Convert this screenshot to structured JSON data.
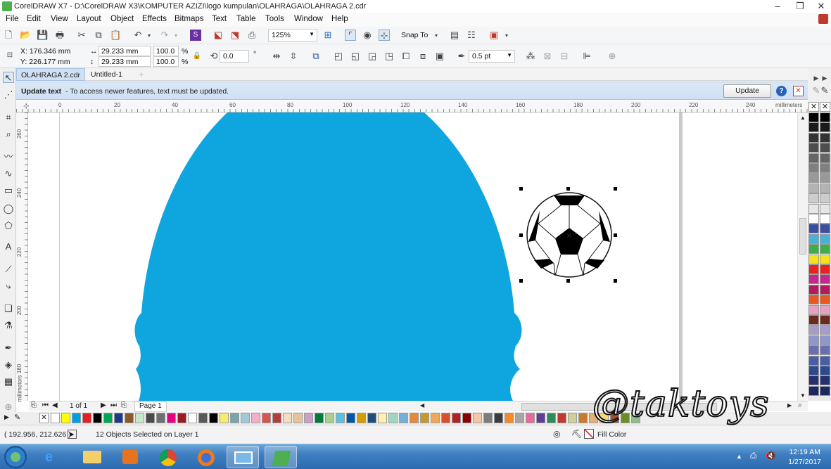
{
  "title": "CorelDRAW X7 - D:\\CorelDRAW X3\\KOMPUTER  AZIZI\\logo kumpulan\\OLAHRAGA\\OLAHRAGA 2.cdr",
  "menu": [
    "File",
    "Edit",
    "View",
    "Layout",
    "Object",
    "Effects",
    "Bitmaps",
    "Text",
    "Table",
    "Tools",
    "Window",
    "Help"
  ],
  "toolbar": {
    "zoom": "125%",
    "snap_to": "Snap To"
  },
  "properties": {
    "x": "X: 176.346 mm",
    "y": "Y: 226.177 mm",
    "width": "29.233 mm",
    "height": "29.233 mm",
    "scale_x": "100.0",
    "scale_y": "100.0",
    "percent": "%",
    "rotation": "0.0",
    "degree": "°",
    "outline": "0.5 pt"
  },
  "doc_tabs": [
    "OLAHRAGA 2.cdr",
    "Untitled-1"
  ],
  "notification": {
    "bold": "Update text",
    "message": "-  To access newer features, text must be updated.",
    "button": "Update"
  },
  "ruler": {
    "h_ticks": [
      "0",
      "20",
      "40",
      "60",
      "80",
      "100",
      "120",
      "140",
      "160",
      "180",
      "200",
      "220",
      "240"
    ],
    "unit": "millimeters",
    "v_ticks": [
      "260",
      "240",
      "220",
      "200",
      "180"
    ],
    "v_unit": "millimeters"
  },
  "page_nav": {
    "count": "1 of 1",
    "page": "Page 1"
  },
  "status": {
    "coords": "( 192.956, 212.626 )",
    "selection": "12 Objects Selected on Layer 1",
    "fill": "Fill Color"
  },
  "clock": {
    "time": "12:19 AM",
    "date": "1/27/2017"
  },
  "watermark": "@taktoys",
  "colors": {
    "shape_fill": "#0fa6e0",
    "notif_bg": "#d5e4f5",
    "taskbar": "#3f7ec0"
  },
  "palette_right": [
    "#000000",
    "#1a1a1a",
    "#333333",
    "#4d4d4d",
    "#666666",
    "#808080",
    "#999999",
    "#b3b3b3",
    "#cccccc",
    "#e6e6e6",
    "#ffffff",
    "#3a4fa0",
    "#4ab0d8",
    "#3fae49",
    "#f6e11a",
    "#e52421",
    "#c6278a",
    "#b01c5c",
    "#e9581f",
    "#e6a1c0",
    "#6b2a1b",
    "#a59cc9",
    "#8f96c9",
    "#6a6fb0",
    "#4a5fa3",
    "#2e4a8f",
    "#25306e",
    "#1e2660"
  ],
  "palette_bottom": [
    "#ffffff",
    "#ffff00",
    "#00a0e0",
    "#e31e24",
    "#000000",
    "#00a651",
    "#1a3a8a",
    "#8a5a2b",
    "#c8e6c9",
    "#4a4a4a",
    "#6d6e71",
    "#e6007e",
    "#9b1c20",
    "#ffffff",
    "#58595b",
    "#000000",
    "#f7ec6b",
    "#7aa5a8",
    "#a5c8d9",
    "#f4b0c8",
    "#d9534f",
    "#b33c3c",
    "#f0e0c0",
    "#e6c39b",
    "#c8a0c8",
    "#007a3d",
    "#a7d08c",
    "#5bc0de",
    "#0057a8",
    "#d39e00",
    "#1f4e79",
    "#fdf0b0",
    "#9ed6c0",
    "#77aed8",
    "#e38a3a",
    "#c49a2c",
    "#f2a65a",
    "#d94f2b",
    "#b22222",
    "#8b0000",
    "#f7c6a5",
    "#7c7c7c",
    "#3b3b3b",
    "#f28c28",
    "#a6a6a6",
    "#e36c9a",
    "#5e3c99",
    "#2e8b57",
    "#c0392b",
    "#cfcf9a",
    "#c97a2c",
    "#e1b07a",
    "#f5d76e",
    "#a0522d",
    "#6b8e23",
    "#8fbc8f"
  ],
  "taskbar_apps": [
    "start-orb",
    "ie",
    "explorer",
    "media-player",
    "chrome",
    "firefox",
    "photo-viewer",
    "coreldraw"
  ]
}
